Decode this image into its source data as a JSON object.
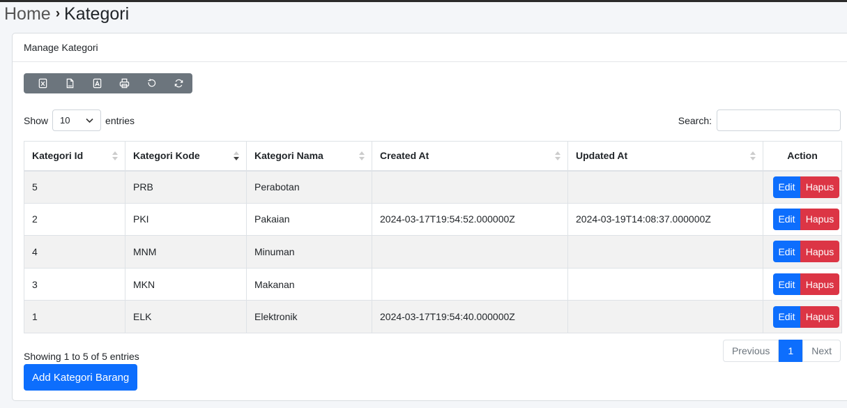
{
  "breadcrumb": {
    "home": "Home",
    "separator": "›",
    "current": "Kategori"
  },
  "card": {
    "title": "Manage Kategori"
  },
  "toolbar": {
    "buttons": [
      "excel-icon",
      "csv-icon",
      "pdf-icon",
      "print-icon",
      "reset-icon",
      "reload-icon"
    ]
  },
  "length": {
    "show_label": "Show",
    "value": "10",
    "entries_label": "entries"
  },
  "search": {
    "label": "Search:",
    "value": ""
  },
  "table": {
    "headers": [
      "Kategori Id",
      "Kategori Kode",
      "Kategori Nama",
      "Created At",
      "Updated At",
      "Action"
    ],
    "rows": [
      [
        "5",
        "PRB",
        "Perabotan",
        "",
        ""
      ],
      [
        "2",
        "PKI",
        "Pakaian",
        "2024-03-17T19:54:52.000000Z",
        "2024-03-19T14:08:37.000000Z"
      ],
      [
        "4",
        "MNM",
        "Minuman",
        "",
        ""
      ],
      [
        "3",
        "MKN",
        "Makanan",
        "",
        ""
      ],
      [
        "1",
        "ELK",
        "Elektronik",
        "2024-03-17T19:54:40.000000Z",
        ""
      ]
    ],
    "edit_label": "Edit",
    "delete_label": "Hapus"
  },
  "info": "Showing 1 to 5 of 5 entries",
  "add_button": "Add Kategori Barang",
  "pagination": {
    "previous": "Previous",
    "current": "1",
    "next": "Next"
  },
  "colors": {
    "primary": "#0d6efd",
    "danger": "#dc3545",
    "secondary": "#6c757d"
  }
}
